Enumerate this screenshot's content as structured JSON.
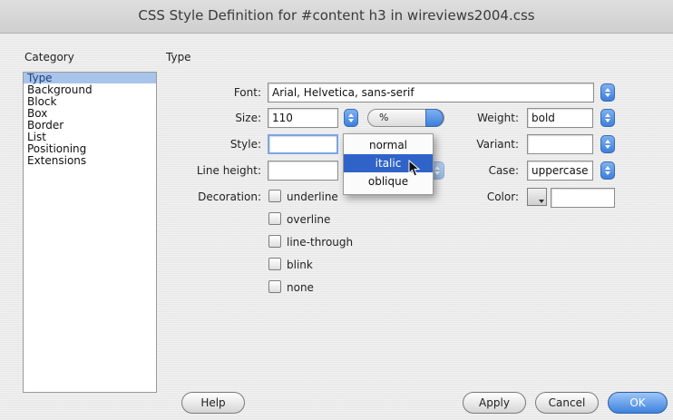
{
  "window": {
    "title": "CSS Style Definition for #content h3 in wireviews2004.css"
  },
  "category": {
    "label": "Category",
    "items": [
      "Type",
      "Background",
      "Block",
      "Box",
      "Border",
      "List",
      "Positioning",
      "Extensions"
    ],
    "selected": "Type"
  },
  "panel": {
    "title": "Type"
  },
  "fields": {
    "font": {
      "label": "Font:",
      "value": "Arial, Helvetica, sans-serif"
    },
    "size": {
      "label": "Size:",
      "value": "110",
      "unit": "%"
    },
    "weight": {
      "label": "Weight:",
      "value": "bold"
    },
    "style": {
      "label": "Style:",
      "value": ""
    },
    "variant": {
      "label": "Variant:",
      "value": ""
    },
    "line_height": {
      "label": "Line height:",
      "value": ""
    },
    "case": {
      "label": "Case:",
      "value": "uppercase"
    },
    "decoration": {
      "label": "Decoration:",
      "options": [
        "underline",
        "overline",
        "line-through",
        "blink",
        "none"
      ]
    },
    "color": {
      "label": "Color:",
      "value": ""
    }
  },
  "style_menu": {
    "options": [
      "normal",
      "italic",
      "oblique"
    ],
    "highlighted": "italic"
  },
  "buttons": {
    "help": "Help",
    "apply": "Apply",
    "cancel": "Cancel",
    "ok": "OK"
  },
  "colors": {
    "selection": "#2f63c8",
    "category_selected": "#a9c4ea",
    "default_button": "#3e82df"
  }
}
